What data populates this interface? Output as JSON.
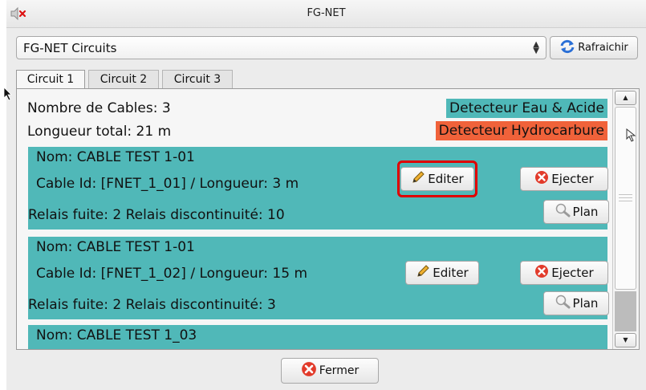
{
  "window": {
    "title": "FG-NET"
  },
  "selector": {
    "value": "FG-NET Circuits"
  },
  "toolbar": {
    "refresh_label": "Rafraichir"
  },
  "tabs": [
    {
      "label": "Circuit 1",
      "active": true
    },
    {
      "label": "Circuit 2",
      "active": false
    },
    {
      "label": "Circuit 3",
      "active": false
    }
  ],
  "summary": {
    "cables_count": "Nombre de Cables: 3",
    "total_length": "Longueur total: 21 m"
  },
  "legend": {
    "water_acid": "Detecteur Eau & Acide",
    "hydrocarbon": "Detecteur Hydrocarbure",
    "water_color": "#4fb8b8",
    "hydrocarbon_color": "#f0623a"
  },
  "cables": [
    {
      "name": "Nom: CABLE TEST 1-01",
      "id_length": "Cable Id: [FNET_1_01] / Longueur: 3 m",
      "relays": "Relais fuite: 2  Relais discontinuité: 10",
      "edit_label": "Editer",
      "eject_label": "Ejecter",
      "plan_label": "Plan",
      "highlighted": true
    },
    {
      "name": "Nom: CABLE TEST 1-01",
      "id_length": "Cable Id: [FNET_1_02] / Longueur: 15 m",
      "relays": "Relais fuite: 2  Relais discontinuité: 3",
      "edit_label": "Editer",
      "eject_label": "Ejecter",
      "plan_label": "Plan",
      "highlighted": false
    },
    {
      "name": "Nom: CABLE TEST 1_03"
    }
  ],
  "footer": {
    "close_label": "Fermer"
  },
  "icons": {
    "mute": "speaker-muted-icon",
    "refresh": "refresh-icon",
    "edit": "pencil-icon",
    "eject": "red-x-circle-icon",
    "plan": "magnifier-icon",
    "close": "red-x-circle-icon"
  },
  "colors": {
    "cable_row": "#50b8b8",
    "highlight": "#e00000"
  }
}
